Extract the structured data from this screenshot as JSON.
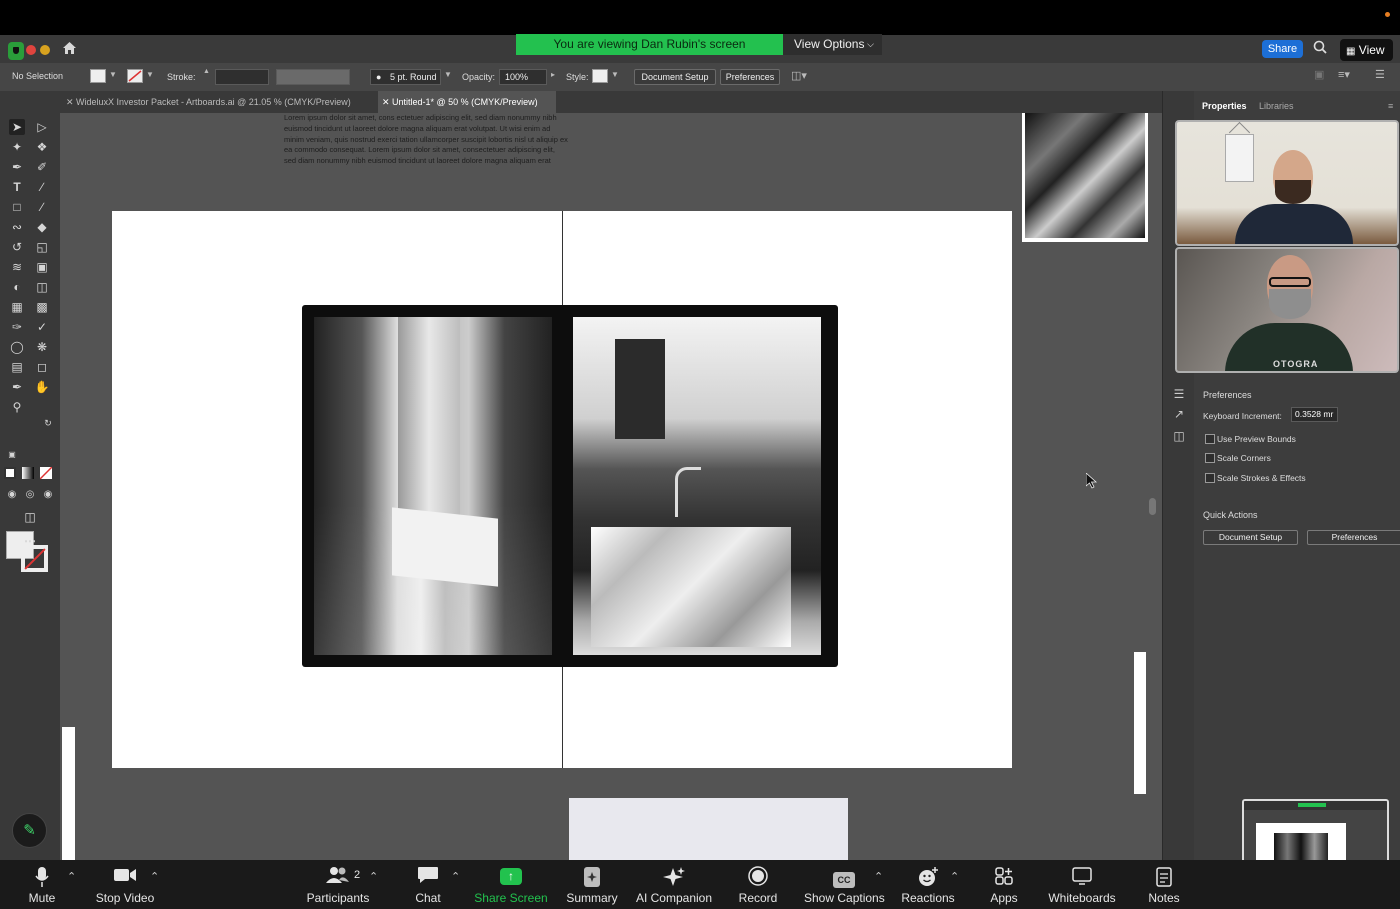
{
  "zoom_top": {
    "viewing_banner": "You are viewing Dan Rubin's screen",
    "view_options": "View Options",
    "share": "Share",
    "view": "View"
  },
  "control_bar": {
    "selection": "No Selection",
    "stroke_label": "Stroke:",
    "brush": "5 pt. Round",
    "opacity_label": "Opacity:",
    "opacity_value": "100%",
    "style_label": "Style:",
    "document_setup": "Document Setup",
    "preferences": "Preferences"
  },
  "tabs": [
    {
      "label": "WideluxX Investor Packet - Artboards.ai @ 21.05 % (CMYK/Preview)"
    },
    {
      "label": "Untitled-1* @ 50 % (CMYK/Preview)"
    }
  ],
  "canvas": {
    "lorem": "Lorem ipsum dolor sit amet, cons ectetuer adipiscing elit, sed diam nonummy nibh euismod tincidunt ut laoreet dolore magna aliquam erat volutpat. Ut wisi enim ad minim veniam, quis nostrud exerci tation ullamcorper suscipit lobortis nisl ut aliquip ex ea commodo consequat. Lorem ipsum dolor sit amet, consectetuer adipiscing elit, sed diam nonummy nibh euismod tincidunt ut laoreet dolore magna aliquam erat"
  },
  "panel": {
    "tab_properties": "Properties",
    "tab_libraries": "Libraries",
    "preferences_heading": "Preferences",
    "keyboard_increment_label": "Keyboard Increment:",
    "keyboard_increment_value": "0.3528 mr",
    "use_preview_bounds": "Use Preview Bounds",
    "scale_corners": "Scale Corners",
    "scale_strokes": "Scale Strokes & Effects",
    "quick_actions": "Quick Actions",
    "document_setup": "Document Setup",
    "preferences": "Preferences"
  },
  "video": {
    "shirt_text": "OTOGRA"
  },
  "bottom_bar": {
    "mute": "Mute",
    "stop_video": "Stop Video",
    "participants": "Participants",
    "participants_count": "2",
    "chat": "Chat",
    "share_screen": "Share Screen",
    "summary": "Summary",
    "ai_companion": "AI Companion",
    "record": "Record",
    "show_captions": "Show Captions",
    "captions_badge": "CC",
    "reactions": "Reactions",
    "apps": "Apps",
    "whiteboards": "Whiteboards",
    "notes": "Notes"
  },
  "colors": {
    "banner_green": "#23c14f",
    "share_blue": "#1d6fd6",
    "share_screen_green": "#22c24e"
  },
  "icons": [
    "shield-icon",
    "home-icon",
    "search-icon",
    "mic-icon",
    "video-camera-icon",
    "participants-icon",
    "chat-icon",
    "share-screen-icon",
    "summary-icon",
    "sparkle-icon",
    "record-icon",
    "captions-icon",
    "reactions-icon",
    "apps-icon",
    "whiteboard-icon",
    "notes-icon",
    "pencil-icon"
  ]
}
